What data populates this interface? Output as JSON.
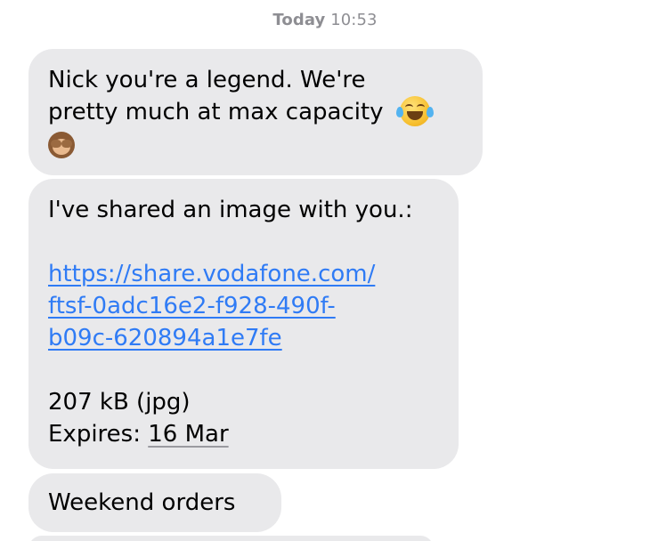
{
  "header": {
    "timestamp_day": "Today",
    "timestamp_time": "10:53"
  },
  "messages": [
    {
      "line1": "Nick you're a legend. We're",
      "line2": "pretty much at max capacity",
      "emoji1": "face-with-tears-of-joy",
      "emoji2": "see-no-evil-monkey"
    },
    {
      "intro": "I've shared an image with you.:",
      "link_line1": "https://share.vodafone.com/",
      "link_line2": "ftsf-0adc16e2-f928-490f-",
      "link_line3": "b09c-620894a1e7fe",
      "size": "207 kB (jpg)",
      "expires_label": "Expires: ",
      "expires_date": "16 Mar"
    },
    {
      "text": "Weekend orders"
    }
  ],
  "colors": {
    "bubble_incoming": "#e9e9eb",
    "link": "#2f7bf5",
    "timestamp": "#8e8e93"
  }
}
